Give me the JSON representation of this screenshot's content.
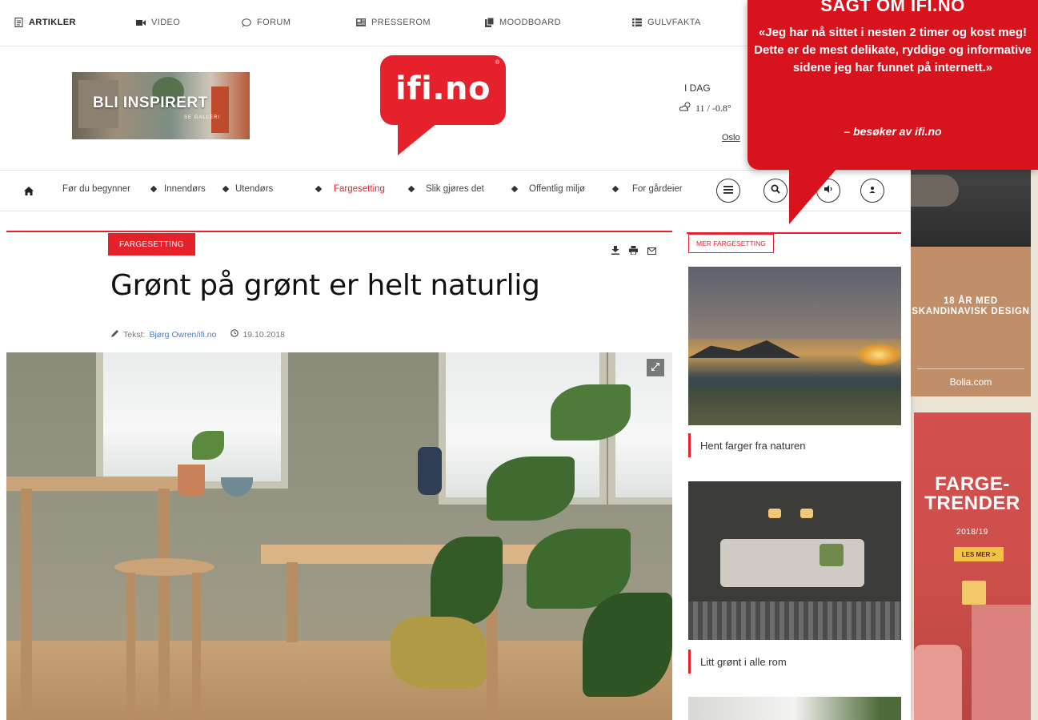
{
  "topnav": {
    "items": [
      {
        "label": "ARTIKLER",
        "icon": "document-icon"
      },
      {
        "label": "VIDEO",
        "icon": "video-icon"
      },
      {
        "label": "FORUM",
        "icon": "chat-icon"
      },
      {
        "label": "PRESSEROM",
        "icon": "newspaper-icon"
      },
      {
        "label": "MOODBOARD",
        "icon": "clipboard-icon"
      },
      {
        "label": "GULVFAKTA",
        "icon": "list-icon"
      }
    ]
  },
  "header": {
    "banner_title": "BLI INSPIRERT",
    "banner_sub": "SE GALLERI",
    "logo_text": "ifi.no",
    "logo_reg": "®",
    "weather_label": "I DAG",
    "weather_temp": "11 / -0.8°",
    "weather_city": "Oslo"
  },
  "mainnav": {
    "items": [
      "Før du begynner",
      "Innendørs",
      "Utendørs",
      "Fargesetting",
      "Slik gjøres det",
      "Offentlig miljø",
      "For gårdeier"
    ],
    "current": "Fargesetting"
  },
  "article": {
    "category": "FARGESETTING",
    "headline": "Grønt på grønt er helt naturlig",
    "byline_prefix": "Tekst:",
    "author": "Bjørg Owren/ifi.no",
    "date": "19.10.2018"
  },
  "sidebar": {
    "tag": "MER FARGESETTING",
    "items": [
      {
        "caption": "Hent farger fra naturen"
      },
      {
        "caption": "Litt grønt i alle rom"
      }
    ]
  },
  "ads": {
    "bolia_text": "18 ÅR MED SKANDINAVISK DESIGN",
    "bolia_brand": "Bolia.com",
    "trends_title_1": "FARGE-",
    "trends_title_2": "TRENDER",
    "trends_year": "2018/19",
    "trends_button": "LES MER >"
  },
  "callout": {
    "heading": "SAGT OM IFI.NO",
    "quote": "«Jeg har nå sittet i nesten 2 timer og kost meg! Dette er de mest delikate, ryddige og informative sidene jeg har funnet på internett.»",
    "source": "– besøker av ifi.no"
  },
  "colors": {
    "brand_red": "#e5222b",
    "callout_red": "#d7131d",
    "link_blue": "#4a7fc4"
  }
}
